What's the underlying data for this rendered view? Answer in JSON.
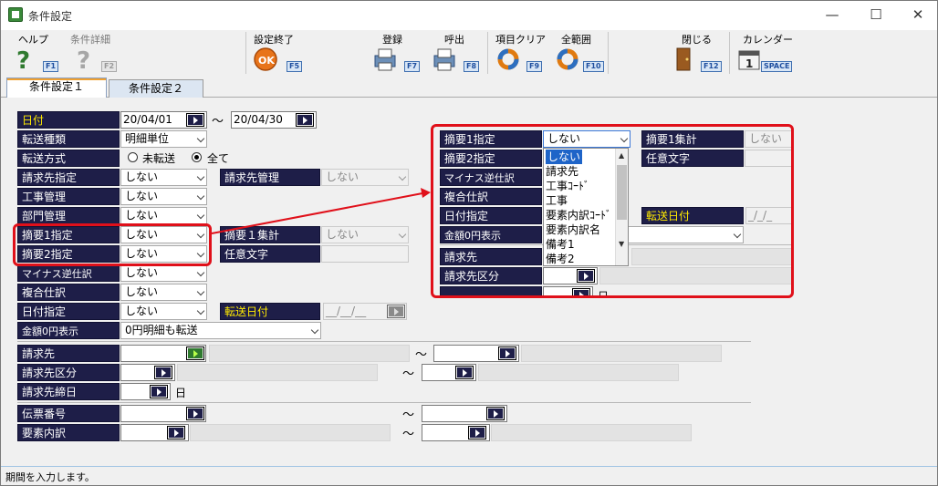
{
  "window": {
    "title": "条件設定",
    "min": "—",
    "max": "☐",
    "close": "✕"
  },
  "toolbar": {
    "help": "ヘルプ",
    "help_key": "F1",
    "detail": "条件詳細",
    "detail_key": "F2",
    "finish": "設定終了",
    "finish_key": "F5",
    "register": "登録",
    "register_key": "F7",
    "recall": "呼出",
    "recall_key": "F8",
    "clear": "項目クリア",
    "clear_key": "F9",
    "allrange": "全範囲",
    "allrange_key": "F10",
    "close": "閉じる",
    "close_key": "F12",
    "calendar": "カレンダー",
    "calendar_key": "SPACE"
  },
  "tabs": [
    "条件設定１",
    "条件設定２"
  ],
  "form": {
    "date_label": "日付",
    "date_from": "20/04/01",
    "tilde": "～",
    "date_to": "20/04/30",
    "transfer_type_label": "転送種類",
    "transfer_type_value": "明細単位",
    "transfer_method_label": "転送方式",
    "radio_untransferred": "未転送",
    "radio_all": "全て",
    "billing_label": "請求先指定",
    "billing_value": "しない",
    "billing_mgmt_label": "請求先管理",
    "billing_mgmt_value": "しない",
    "construction_label": "工事管理",
    "construction_value": "しない",
    "dept_label": "部門管理",
    "dept_value": "しない",
    "summary1_label": "摘要1指定",
    "summary1_value": "しない",
    "summary2_label": "摘要2指定",
    "summary2_value": "しない",
    "summary1_total_label": "摘要１集計",
    "summary1_total_value": "しない",
    "free_text_label": "任意文字",
    "minus_label": "マイナス逆仕訳",
    "minus_value": "しない",
    "compound_label": "複合仕訳",
    "compound_value": "しない",
    "date_spec_label": "日付指定",
    "date_spec_value": "しない",
    "transfer_date_label": "転送日付",
    "transfer_date_value": "__/__/__",
    "zero_label": "金額0円表示",
    "zero_value": "0円明細も転送",
    "customer_label": "請求先",
    "customer_class_label": "請求先区分",
    "closing_label": "請求先締日",
    "closing_unit": "日",
    "slip_label": "伝票番号",
    "element_label": "要素内訳"
  },
  "zoom": {
    "summary1_label": "摘要1指定",
    "summary1_value": "しない",
    "summary2_label": "摘要2指定",
    "minus_label": "マイナス逆仕訳",
    "compound_label": "複合仕訳",
    "date_spec_label": "日付指定",
    "zero_label": "金額0円表示",
    "customer_label": "請求先",
    "customer_class_label": "請求先区分",
    "total_label": "摘要1集計",
    "total_value": "しない",
    "free_text_label": "任意文字",
    "transfer_date_label": "転送日付",
    "transfer_date_value": "_/_/_",
    "closing_unit": "日",
    "options": [
      "しない",
      "請求先",
      "工事ｺｰﾄﾞ",
      "工事",
      "要素内訳ｺｰﾄﾞ",
      "要素内訳名",
      "備考1",
      "備考2"
    ]
  },
  "status": "期間を入力します。"
}
